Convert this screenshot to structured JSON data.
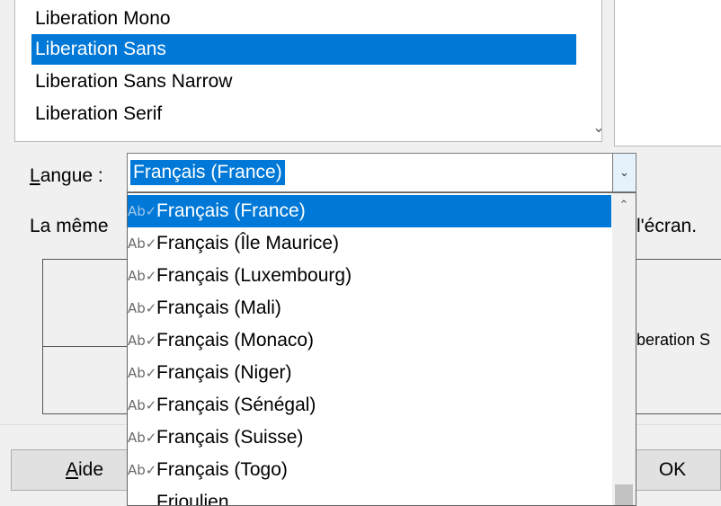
{
  "font_list": {
    "items": [
      "Liberation Mono",
      "Liberation Sans",
      "Liberation Sans Narrow",
      "Liberation Serif"
    ],
    "selected": "Liberation Sans",
    "scroll_arrow": "⌄"
  },
  "language": {
    "label_prefix": "L",
    "label_rest": "angue :",
    "value": "Français (France)",
    "arrow": "⌄"
  },
  "info": {
    "left_text": "La même",
    "right_text": "l'écran."
  },
  "preview": {
    "text": "beration S"
  },
  "buttons": {
    "help_prefix": "A",
    "help_rest": "ide",
    "ok": "OK"
  },
  "dropdown": {
    "items": [
      {
        "label": "Français (France)",
        "icon": "Ab✓",
        "selected": true
      },
      {
        "label": "Français (Île Maurice)",
        "icon": "Ab✓"
      },
      {
        "label": "Français (Luxembourg)",
        "icon": "Ab✓"
      },
      {
        "label": "Français (Mali)",
        "icon": "Ab✓"
      },
      {
        "label": "Français (Monaco)",
        "icon": "Ab✓"
      },
      {
        "label": "Français (Niger)",
        "icon": "Ab✓"
      },
      {
        "label": "Français (Sénégal)",
        "icon": "Ab✓"
      },
      {
        "label": "Français (Suisse)",
        "icon": "Ab✓"
      },
      {
        "label": "Français (Togo)",
        "icon": "Ab✓"
      },
      {
        "label": "Frioulien",
        "icon": ""
      }
    ],
    "scroll_up": "⌃"
  },
  "colors": {
    "selection": "#0078d7",
    "window_bg": "#f0f0f0"
  }
}
